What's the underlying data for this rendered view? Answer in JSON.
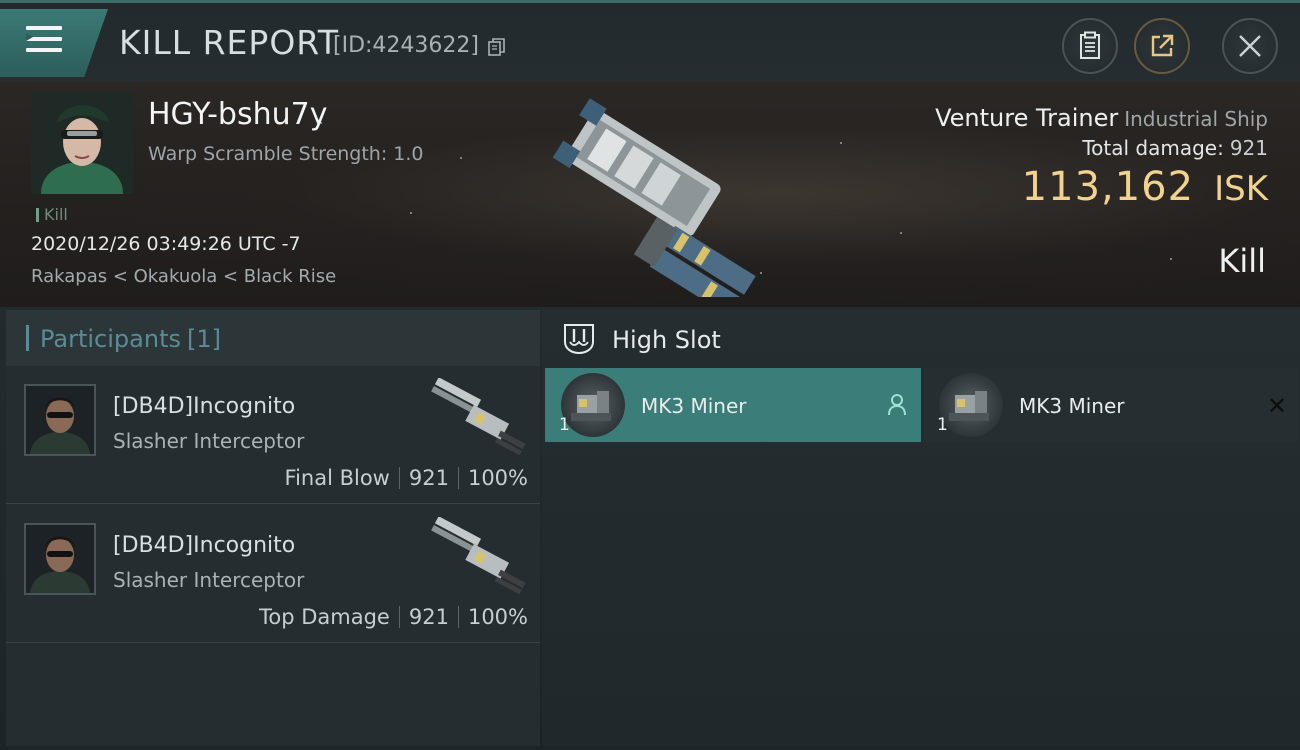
{
  "header": {
    "title": "KILL REPORT",
    "id_label": "[ID:4243622]"
  },
  "victim": {
    "name": "HGY-bshu7y",
    "warp_scramble": "Warp Scramble Strength: 1.0",
    "tag": "Kill",
    "timestamp": "2020/12/26 03:49:26 UTC -7",
    "location": "Rakapas < Okakuola < Black Rise",
    "ship_name": "Venture Trainer",
    "ship_class": "Industrial Ship",
    "total_damage_label": "Total damage:",
    "total_damage": "921",
    "isk_value": "113,162",
    "isk_unit": "ISK",
    "result": "Kill"
  },
  "participants": {
    "title": "Participants",
    "count": "[1]",
    "rows": [
      {
        "name": "[DB4D]Incognito",
        "ship": "Slasher Interceptor",
        "role": "Final Blow",
        "damage": "921",
        "percent": "100%"
      },
      {
        "name": "[DB4D]Incognito",
        "ship": "Slasher Interceptor",
        "role": "Top Damage",
        "damage": "921",
        "percent": "100%"
      }
    ]
  },
  "fitting": {
    "slot_title": "High Slot",
    "modules": [
      {
        "name": "MK3 Miner",
        "qty": "1",
        "selected": true,
        "icon": "person-icon"
      },
      {
        "name": "MK3 Miner",
        "qty": "1",
        "selected": false,
        "icon": "close-icon"
      }
    ]
  },
  "colors": {
    "accent": "#3b7d78",
    "isk": "#f1d38f",
    "participants_title": "#5b8c96"
  }
}
